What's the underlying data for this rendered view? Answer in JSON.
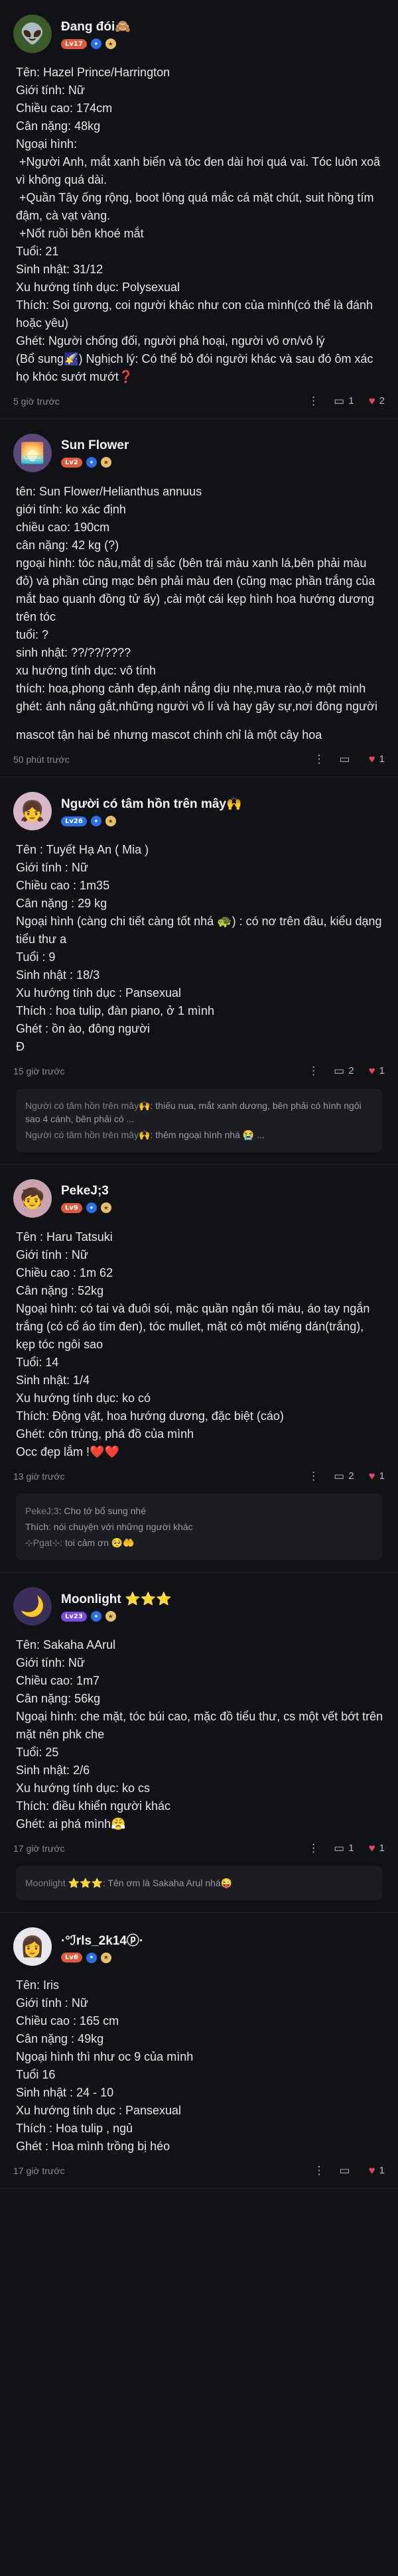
{
  "posts": [
    {
      "name": "Đang đói🙈",
      "level": "Lv17",
      "level_color": "#e0593a",
      "avatar_bg": "#3a5a2a",
      "avatar_emoji": "👽",
      "lines": [
        "Tên: Hazel Prince/Harrington",
        "Giới tính: Nữ",
        "Chiều cao: 174cm",
        "Cân nặng: 48kg",
        "Ngoại hình:",
        " +Người Anh, mắt xanh biển và tóc đen dài hơi quá vai. Tóc luôn xoã vì không quá dài.",
        " +Quần Tây ống rộng, boot lông quá mắc cá mặt chút, suit hồng tím đậm, cà vạt vàng.",
        " +Nốt ruồi bên khoé mắt",
        "Tuổi: 21",
        "Sinh nhật: 31/12",
        "Xu hướng tính dục: Polysexual",
        "Thích: Soi gương, coi người khác như con của mình(có thể là đánh hoặc yêu)",
        "Ghét: Người chống đối, người phá hoại, người vô ơn/vô lý",
        "(Bổ sung🌠) Nghịch lý: Có thể bỏ đói người khác và sau đó ôm xác họ khóc sướt mướt❓"
      ],
      "time": "5 giờ trước",
      "comments": "1",
      "likes": "2",
      "replies": []
    },
    {
      "name": "Sun Flower",
      "level": "Lv2",
      "level_color": "#e0593a",
      "avatar_bg": "#5a4a7a",
      "avatar_emoji": "🌅",
      "lines": [
        "tên: Sun Flower/Helianthus annuus",
        "giới tính: ko xác định",
        "chiều cao: 190cm",
        "cân nặng: 42 kg (?)",
        "ngoại hình: tóc nâu,mắt dị sắc (bên trái màu xanh lá,bên phải màu đỏ) và phần cũng mạc bên phải màu đen (cũng mạc phần trắng của mắt bao quanh đồng tử ấy) ,cài một cái kẹp hình hoa hướng dương trên tóc",
        "tuổi: ?",
        "sinh nhật: ??/??/????",
        "xu hướng tính dục: vô tính",
        "thích: hoa,phong cảnh đẹp,ánh nắng dịu nhẹ,mưa rào,ở một mình",
        "ghét: ánh nắng gắt,những người vô lí và hay gây sự,nơi đông người",
        "",
        "mascot tận hai bé nhưng mascot chính chỉ là một cây hoa"
      ],
      "time": "50 phút trước",
      "comments": "",
      "likes": "1",
      "replies": []
    },
    {
      "name": "Người có tâm hồn trên mây🙌",
      "level": "Lv26",
      "level_color": "#2a6fe8",
      "avatar_bg": "#d8b8c8",
      "avatar_emoji": "👧",
      "lines": [
        "Tên : Tuyết Hạ An ( Mia )",
        "Giới tính : Nữ",
        "Chiều cao : 1m35",
        "Cân nặng : 29 kg",
        "Ngoại hình (càng chi tiết càng tốt nhá 🐢) : có nơ trên đầu, kiểu dạng tiểu thư a",
        "Tuổi : 9",
        "Sinh nhật : 18/3",
        "Xu hướng tính dục : Pansexual",
        "Thích : hoa tulip, đàn piano, ở 1 mình",
        "Ghét : ồn ào, đông người",
        "Đ"
      ],
      "time": "15 giờ trước",
      "comments": "2",
      "likes": "1",
      "replies": [
        {
          "name": "Người có tâm hồn trên mây🙌",
          "text": ": thiếu nua, mắt xanh dương, bên phải có hình ngôi sao 4 cánh, bên phải có ..."
        },
        {
          "name": "Người có tâm hồn trên mây🙌",
          "text": ": thêm ngoại hình nhá 😭 ..."
        }
      ]
    },
    {
      "name": "PekeJ;3",
      "level": "Lv9",
      "level_color": "#e0593a",
      "avatar_bg": "#c9a3b0",
      "avatar_emoji": "🧒",
      "lines": [
        "Tên : Haru Tatsuki",
        "Giới tính : Nữ",
        "Chiều cao : 1m 62",
        "Cân nặng : 52kg",
        "Ngoại hình: có tai và đuôi sói, mặc quần ngắn tối màu, áo tay ngắn trắng (có cổ áo tím đen), tóc mullet, mặt có một miếng dán(trắng), kẹp tóc ngôi sao",
        "Tuổi: 14",
        "Sinh nhật: 1/4",
        "Xu hướng tính dục: ko có",
        "Thích: Động vật, hoa hướng dương, đặc biệt (cáo)",
        "Ghét: côn trùng, phá đồ của mình",
        "Occ đẹp lắm !❤️❤️"
      ],
      "time": "13 giờ trước",
      "comments": "2",
      "likes": "1",
      "replies": [
        {
          "name": "PekeJ;3",
          "text": ": Cho tớ bổ sung nhé"
        },
        {
          "name": "",
          "text": "Thích: nói chuyện với những người khác"
        },
        {
          "name": "⊹Pgat⊹",
          "text": ": toi cảm ơn 🥺🤲"
        }
      ]
    },
    {
      "name": "Moonlight ⭐⭐⭐",
      "level": "Lv23",
      "level_color": "#7a4ae0",
      "avatar_bg": "#3a2f5a",
      "avatar_emoji": "🌙",
      "lines": [
        "Tên: Sakaha AArul",
        "Giới tính: Nữ",
        "Chiều cao: 1m7",
        "Cân nặng: 56kg",
        "Ngoại hình: che mặt, tóc búi cao, mặc đồ tiểu thư, cs một vết bớt trên mặt nên phk che",
        "Tuổi: 25",
        "Sinh nhật: 2/6",
        "Xu hướng tính dục: ko cs",
        "Thích: điều khiển người khác",
        "Ghét: ai phá mình😤"
      ],
      "time": "17 giờ trước",
      "comments": "1",
      "likes": "1",
      "replies": [
        {
          "name": "Moonlight ⭐⭐⭐",
          "text": ": Tên ơm là Sakaha Arul nhá😜"
        }
      ]
    },
    {
      "name": "·°ℐrls_2k14ⓟ·",
      "level": "Lv6",
      "level_color": "#e0593a",
      "avatar_bg": "#e8e8ec",
      "avatar_emoji": "👩",
      "lines": [
        "Tên: Iris",
        "Giới tính : Nữ",
        "Chiều cao : 165 cm",
        "Cân nặng : 49kg",
        "Ngoại hình thì như oc 9 của mình",
        "Tuổi 16",
        "Sinh nhật : 24 - 10",
        "Xu hướng tính dục : Pansexual",
        "Thích : Hoa tulip , ngủ",
        "Ghét : Hoa mình trồng bị héo"
      ],
      "time": "17 giờ trước",
      "comments": "",
      "likes": "1",
      "replies": []
    }
  ]
}
